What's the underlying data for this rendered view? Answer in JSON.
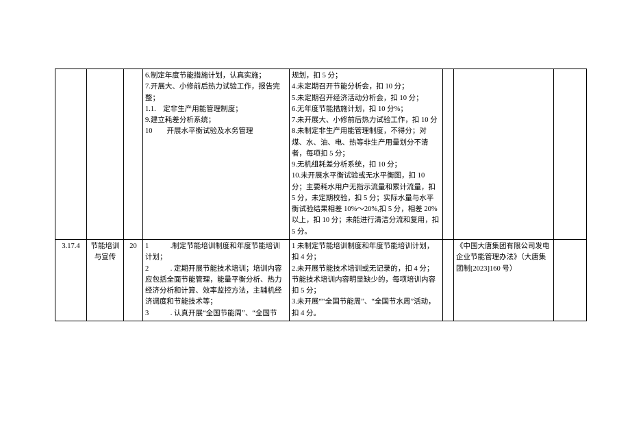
{
  "rows": [
    {
      "idx": "",
      "name": "",
      "score": "",
      "requirement": "6.制定年度节能措施计划，认真实施；\n7.开展大、小修前后热力试验工作，报告完整；\n1.1.　定非生产用能管理制度；\n9.建立耗差分析系统；\n10　　开展水平衡试验及水务管理",
      "criteria": "规划，扣 5 分；\n4.未定期召开节能分析会，扣 10 分；\n5.未定期召开经济活动分析会，扣 10 分；\n6.无年度节能措施计划，扣 10 分%；\n7.未开展大、小修前后热力试验工作，扣 10 分\n8.未制定非生产用能管理制度，不得分；对煤、水、油、电、热等非生产用量划分不清者，每项扣 5 分；\n9.无机组耗差分析系统，扣 10 分；\n10.未开展水平衡试验或无水平衡图，扣 10 分；主要耗水用户无指示流量和累计流量，扣 5 分，未定期校验，扣 5 分；实际水量与水平衡试验结果相差 10%～20%,扣 5 分，相差 20%以上，扣 10 分；未能进行清洁分流和复用，扣 5 分。",
      "colx": "",
      "reference": "",
      "coly": ""
    },
    {
      "idx": "3.17.4",
      "name": "节能培训与宣传",
      "score": "20",
      "requirement": "1　　　.制定节能培训制度和年度节能培训计划；\n2　　　. 定期开展节能技术培训；培训内容应包括全面节能管理，能量平衡分析、热力经济分析和计算、效率监控方法，主辅机经济调度和节能技术等；\n3　　　. 认真开展“全国节能周”、“全国节",
      "criteria": "1 未制定节能培训制度和年度节能培训计划，扣 4 分；\n2.未开展节能技术培训或无记录的，扣 4 分；节能技术培训内容明显缺少的，每项培训内容扣 5 分；\n3.未开展““全国节能周”、“全国节水周”活动，扣 4 分。",
      "colx": "",
      "reference": "《中国大唐集团有限公司发电企业节能管理办法》（大唐集团制[2023]160 号）",
      "coly": ""
    }
  ]
}
